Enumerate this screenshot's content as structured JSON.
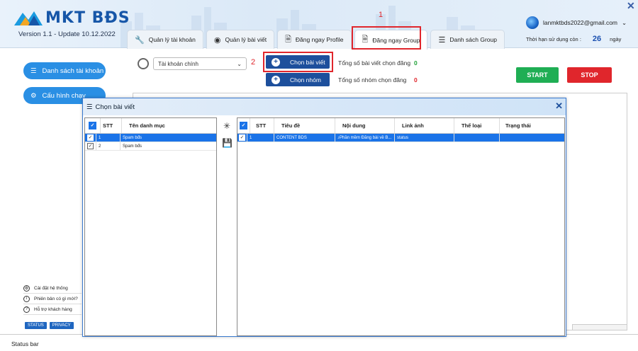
{
  "app": {
    "brand": "MKT BĐS",
    "version": "Version 1.1 - Update 10.12.2022"
  },
  "tabs": [
    {
      "label": "Quản lý tài khoản",
      "icon": "wrench-icon",
      "glyph": "🔧"
    },
    {
      "label": "Quản lý bài viết",
      "icon": "eye-icon",
      "glyph": "◉"
    },
    {
      "label": "Đăng ngay Profile",
      "icon": "doc-icon",
      "glyph": "🗎"
    },
    {
      "label": "Đăng ngay Group",
      "icon": "doc-settings-icon",
      "glyph": "🗎",
      "active": true
    },
    {
      "label": "Danh sách Group",
      "icon": "list-icon",
      "glyph": "☰"
    }
  ],
  "annotations": {
    "one": "1",
    "two": "2"
  },
  "user": {
    "email": "lanmktbds2022@gmail.com",
    "expiry_label": "Thời hạn sử dụng còn :",
    "expiry_value": "26",
    "expiry_unit": "ngày"
  },
  "sidebar": {
    "accounts": "Danh sách tài khoản",
    "config": "Cấu hình chạy",
    "links": [
      "Cài đặt hệ thống",
      "Phiên bản có gì mới?",
      "Hỗ trợ khách hàng"
    ],
    "badges": [
      "STATUS",
      "PRIVACY"
    ]
  },
  "toolbar": {
    "account_select": "Tài khoản chính",
    "choose_posts": "Chọn bài viết",
    "choose_groups": "Chọn nhóm",
    "posts_count_label": "Tổng số bài viết chọn đăng",
    "posts_count": "0",
    "groups_count_label": "Tổng số nhóm chọn đăng",
    "groups_count": "0",
    "start": "START",
    "stop": "STOP"
  },
  "dialog": {
    "title": "Chọn bài viết",
    "left": {
      "headers": [
        "STT",
        "Tên danh mục"
      ],
      "rows": [
        [
          "1",
          "Spam bđs"
        ],
        [
          "2",
          "Spam bđs"
        ]
      ]
    },
    "right": {
      "headers": [
        "STT",
        "Tiêu đề",
        "Nội dung",
        "Link ảnh",
        "Thể loại",
        "Trạng thái"
      ],
      "rows": [
        [
          "1",
          "CONTENT BDS",
          "♪Phần mềm Đăng bài về B...",
          "status",
          "",
          ""
        ]
      ]
    }
  },
  "statusbar": "Status bar",
  "colors": {
    "primary": "#1d4f9c",
    "accent": "#2a8fe4",
    "start": "#1fae54",
    "stop": "#e0262c",
    "highlight": "#e0262c"
  }
}
